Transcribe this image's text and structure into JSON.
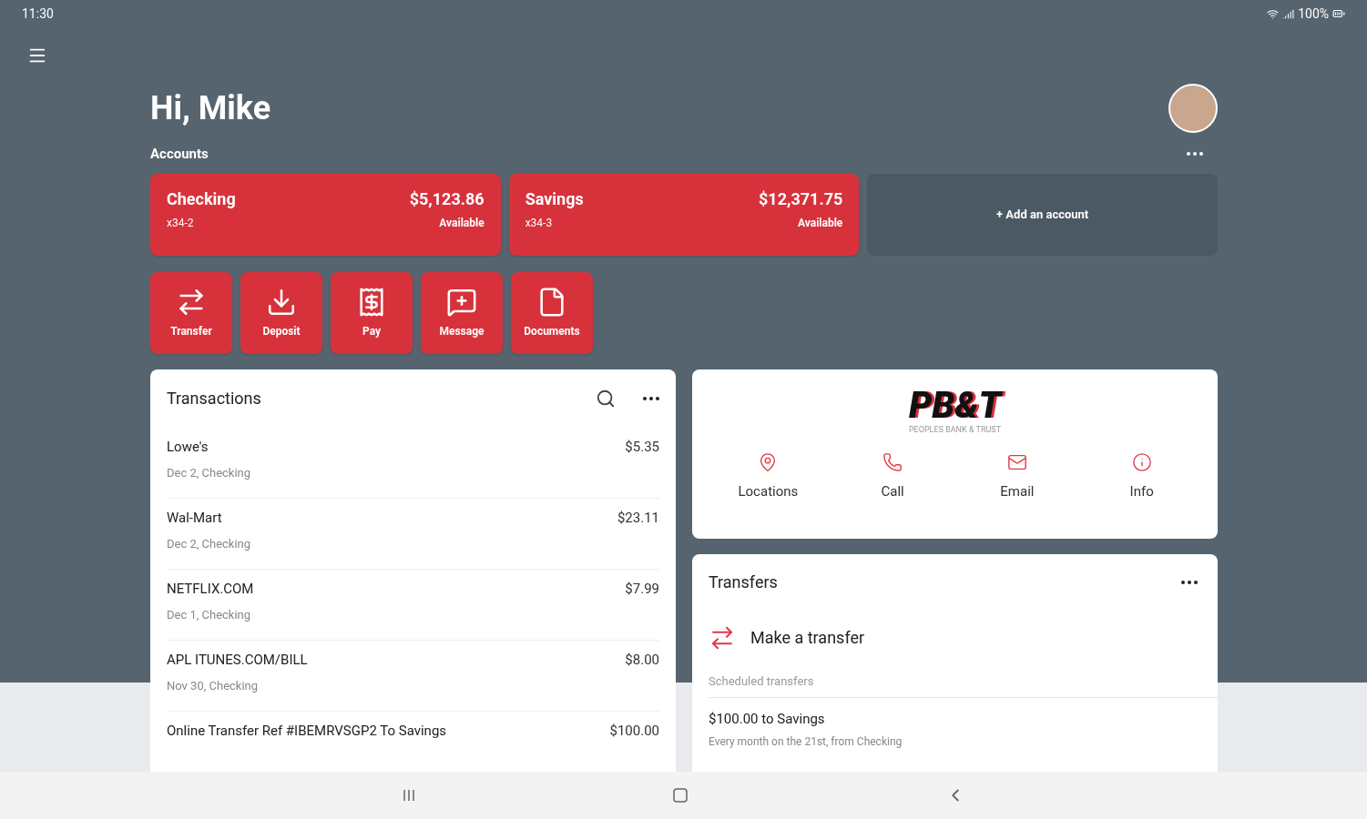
{
  "status_bar": {
    "time": "11:30",
    "battery": "100%"
  },
  "greeting": "Hi, Mike",
  "accounts_label": "Accounts",
  "accounts": [
    {
      "name": "Checking",
      "number": "x34-2",
      "balance": "$5,123.86",
      "balance_label": "Available"
    },
    {
      "name": "Savings",
      "number": "x34-3",
      "balance": "$12,371.75",
      "balance_label": "Available"
    }
  ],
  "add_account": "+ Add an account",
  "actions": [
    {
      "kind": "transfer",
      "label": "Transfer"
    },
    {
      "kind": "deposit",
      "label": "Deposit"
    },
    {
      "kind": "pay",
      "label": "Pay"
    },
    {
      "kind": "message",
      "label": "Message"
    },
    {
      "kind": "documents",
      "label": "Documents"
    }
  ],
  "transactions": {
    "title": "Transactions",
    "rows": [
      {
        "name": "Lowe's",
        "amount": "$5.35",
        "detail": "Dec 2, Checking"
      },
      {
        "name": "Wal-Mart",
        "amount": "$23.11",
        "detail": "Dec 2, Checking"
      },
      {
        "name": "NETFLIX.COM",
        "amount": "$7.99",
        "detail": "Dec 1, Checking"
      },
      {
        "name": "APL ITUNES.COM/BILL",
        "amount": "$8.00",
        "detail": "Nov 30, Checking"
      },
      {
        "name": "Online Transfer Ref #IBEMRVSGP2 To Savings",
        "amount": "$100.00"
      }
    ]
  },
  "bank": {
    "logo": "PB&T",
    "tagline": "PEOPLES BANK & TRUST",
    "links": [
      {
        "kind": "locations",
        "label": "Locations"
      },
      {
        "kind": "call",
        "label": "Call"
      },
      {
        "kind": "email",
        "label": "Email"
      },
      {
        "kind": "info",
        "label": "Info"
      }
    ]
  },
  "transfers": {
    "title": "Transfers",
    "action": "Make a transfer",
    "section": "Scheduled transfers",
    "items": [
      {
        "title": "$100.00 to Savings",
        "detail": "Every month on the 21st, from Checking"
      }
    ]
  }
}
